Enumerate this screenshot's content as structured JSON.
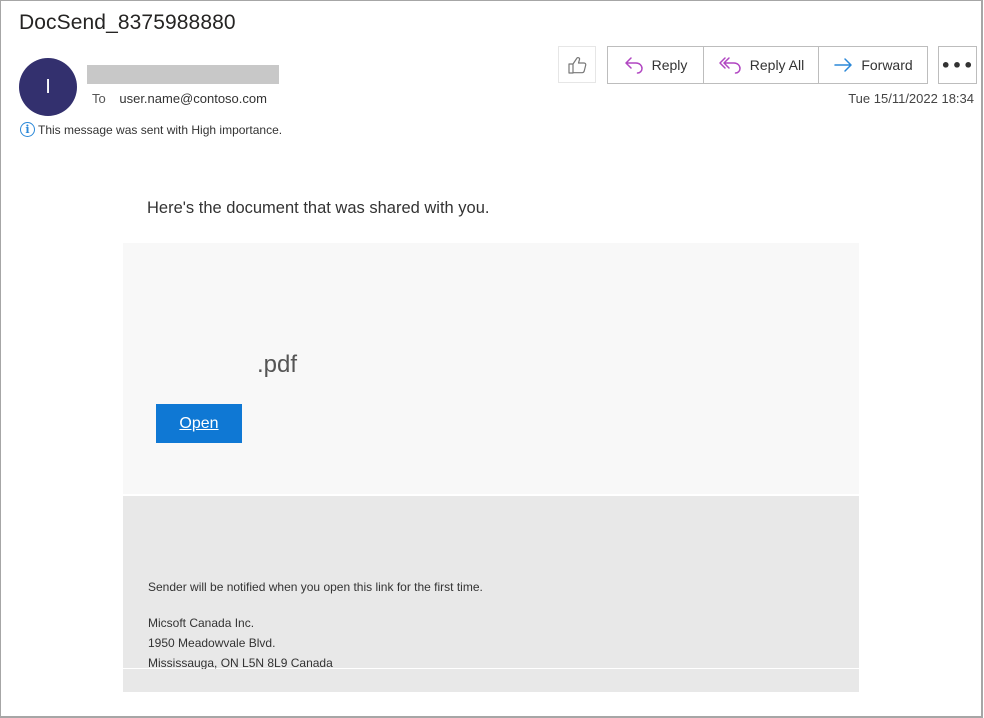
{
  "email": {
    "subject": "DocSend_8375988880",
    "sender_initial": "I",
    "to_label": "To",
    "to_address": "user.name@contoso.com",
    "importance_notice": "This message was sent with High importance.",
    "timestamp": "Tue 15/11/2022 18:34"
  },
  "toolbar": {
    "like_icon": "thumbs-up-icon",
    "reply_label": "Reply",
    "reply_all_label": "Reply All",
    "forward_label": "Forward",
    "more_label": "•••"
  },
  "colors": {
    "avatar": "#33306e",
    "reply_icon": "#b146c2",
    "forward_icon": "#2b88d8",
    "open_button": "#0f78d4",
    "info_icon": "#2b88d8"
  },
  "body": {
    "intro": "Here's the document that was shared with you.",
    "filename": ".pdf",
    "open_label": "Open",
    "footer_notice": "Sender will be notified when you open this link for the first time.",
    "address_lines": [
      "Micsoft Canada Inc.",
      "1950 Meadowvale Blvd.",
      "Mississauga, ON L5N 8L9 Canada"
    ]
  }
}
